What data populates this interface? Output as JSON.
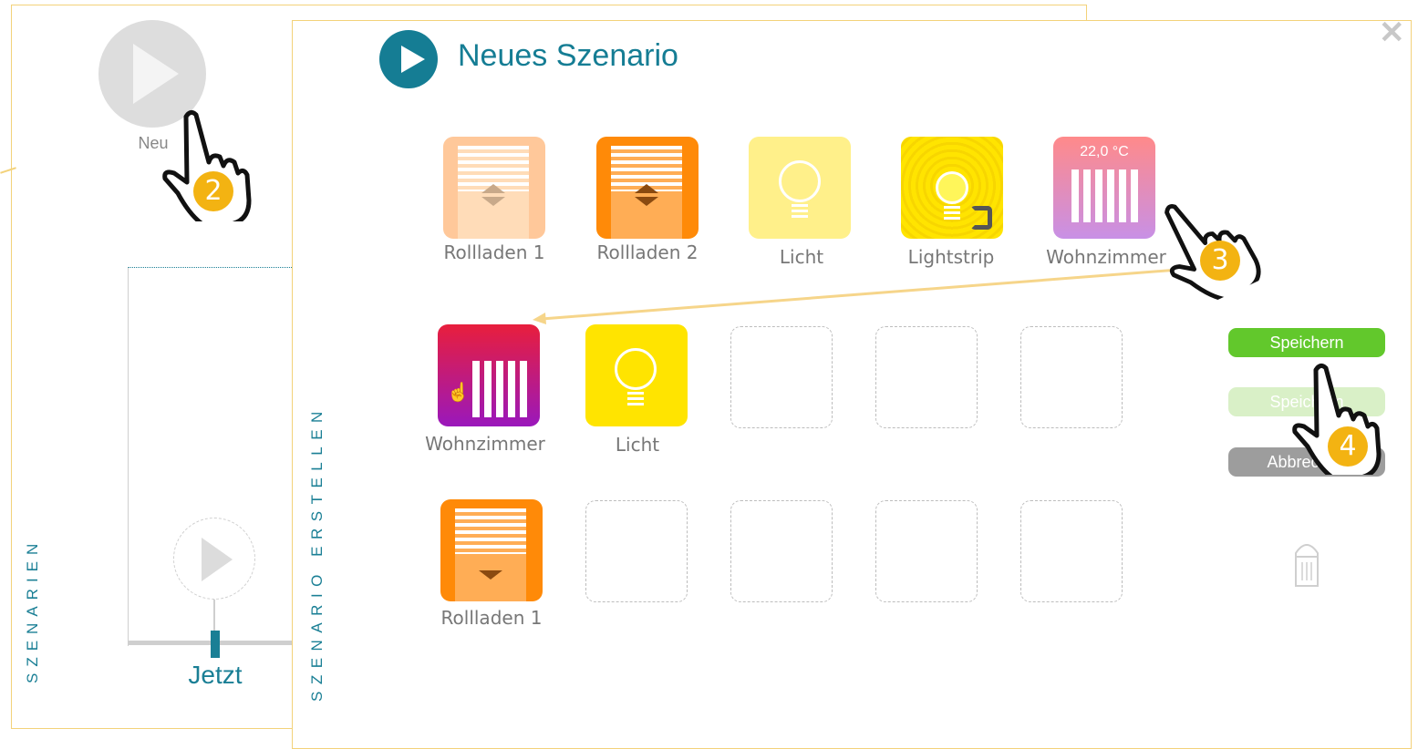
{
  "background": {
    "vertical_label": "SZENARIEN",
    "new_button_label": "Neu",
    "now_label": "Jetzt"
  },
  "dialog": {
    "title": "Neues Szenario",
    "vertical_label": "SZENARIO ERSTELLEN",
    "devices": [
      {
        "label": "Rollladen 1"
      },
      {
        "label": "Rollladen 2"
      },
      {
        "label": "Licht"
      },
      {
        "label": "Lightstrip"
      },
      {
        "label": "Wohnzimmer",
        "temperature": "22,0 °C"
      }
    ],
    "scenario_rows": [
      [
        {
          "label": "Wohnzimmer"
        },
        {
          "label": "Licht"
        }
      ],
      [
        {
          "label": "Rollladen 1"
        }
      ]
    ],
    "buttons": {
      "save": "Speichern",
      "save_disabled": "Speichern",
      "cancel": "Abbrechen"
    }
  },
  "steps": [
    "2",
    "3",
    "4"
  ],
  "colors": {
    "accent": "#157d94",
    "frame": "#f3d27a",
    "save": "#62c82c",
    "cancel": "#9d9d9d",
    "step_badge": "#f3b312"
  }
}
